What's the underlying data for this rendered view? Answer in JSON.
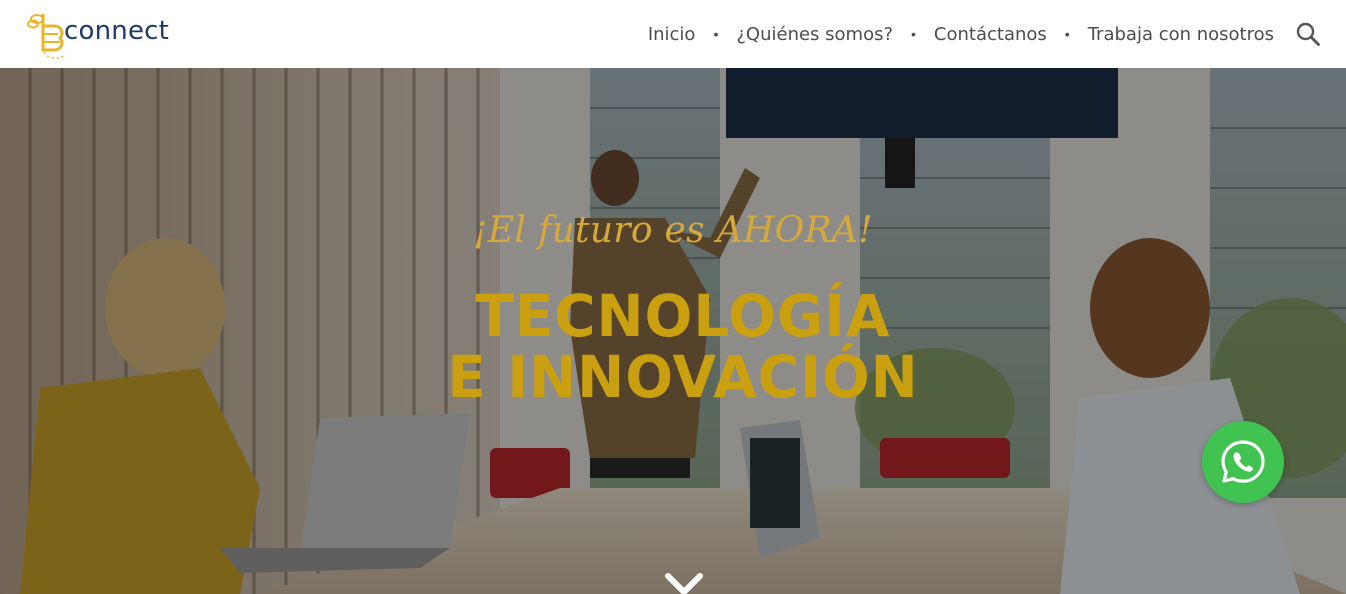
{
  "brand": {
    "name": "connect",
    "color": "#1d3b6b",
    "accent": "#e8b52a"
  },
  "nav": {
    "items": [
      {
        "label": "Inicio"
      },
      {
        "label": "¿Quiénes somos?"
      },
      {
        "label": "Contáctanos"
      },
      {
        "label": "Trabaja con nosotros"
      }
    ],
    "separator": "•",
    "search_icon": "search-icon"
  },
  "hero": {
    "tagline": "¡El futuro es AHORA!",
    "headline_line1": "TECNOLOGÍA",
    "headline_line2": "E INNOVACIÓN",
    "colors": {
      "tagline": "#d7a93a",
      "headline": "#caa010"
    },
    "scroll_icon": "chevron-down-icon"
  },
  "whatsapp": {
    "icon": "whatsapp-icon",
    "color": "#40c351"
  }
}
